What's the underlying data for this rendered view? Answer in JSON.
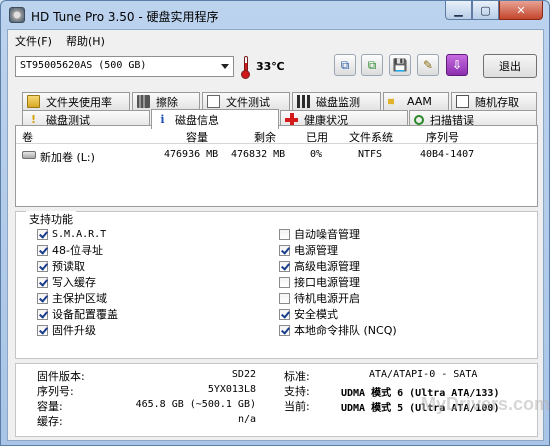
{
  "window": {
    "title": "HD Tune Pro 3.50 - 硬盘实用程序"
  },
  "menu": {
    "file": "文件(F)",
    "help": "帮助(H)"
  },
  "toolbar": {
    "drive": "ST95005620AS (500 GB)",
    "temperature": "33℃",
    "exit_label": "退出"
  },
  "tabs_top": [
    "文件夹使用率",
    "擦除",
    "文件测试",
    "磁盘监测",
    "AAM",
    "随机存取"
  ],
  "tabs_bottom": [
    "磁盘测试",
    "磁盘信息",
    "健康状况",
    "扫描错误"
  ],
  "active_tab": "磁盘信息",
  "list": {
    "headers": [
      "卷",
      "容量",
      "剩余",
      "已用",
      "文件系统",
      "序列号"
    ],
    "rows": [
      {
        "volume": "新加卷 (L:)",
        "capacity": "476936 MB",
        "free": "476832 MB",
        "used": "0%",
        "fs": "NTFS",
        "serial": "40B4-1407"
      }
    ]
  },
  "features": {
    "title": "支持功能",
    "left": [
      {
        "label": "S.M.A.R.T",
        "checked": true
      },
      {
        "label": "48-位寻址",
        "checked": true
      },
      {
        "label": "预读取",
        "checked": true
      },
      {
        "label": "写入缓存",
        "checked": true
      },
      {
        "label": "主保护区域",
        "checked": true
      },
      {
        "label": "设备配置覆盖",
        "checked": true
      },
      {
        "label": "固件升级",
        "checked": true
      }
    ],
    "right": [
      {
        "label": "自动噪音管理",
        "checked": false
      },
      {
        "label": "电源管理",
        "checked": true
      },
      {
        "label": "高级电源管理",
        "checked": true
      },
      {
        "label": "接口电源管理",
        "checked": false
      },
      {
        "label": "待机电源开启",
        "checked": false
      },
      {
        "label": "安全模式",
        "checked": true
      },
      {
        "label": "本地命令排队 (NCQ)",
        "checked": true
      }
    ]
  },
  "info": {
    "firmware_label": "固件版本:",
    "firmware": "SD22",
    "serial_label": "序列号:",
    "serial": "5YX013L8",
    "capacity_label": "容量:",
    "capacity": "465.8 GB (~500.1 GB)",
    "cache_label": "缓存:",
    "cache": "n/a",
    "standard_label": "标准:",
    "standard": "ATA/ATAPI-0 - SATA",
    "supported_label": "支持:",
    "supported": "UDMA 模式 6 (Ultra ATA/133)",
    "current_label": "当前:",
    "current": "UDMA 模式 5 (Ultra ATA/100)"
  },
  "watermark": "MyDrivers.com",
  "colors": {
    "title_bar": "#bcd3ee",
    "close_button": "#c3452c",
    "check_mark": "#1a3c8c"
  }
}
